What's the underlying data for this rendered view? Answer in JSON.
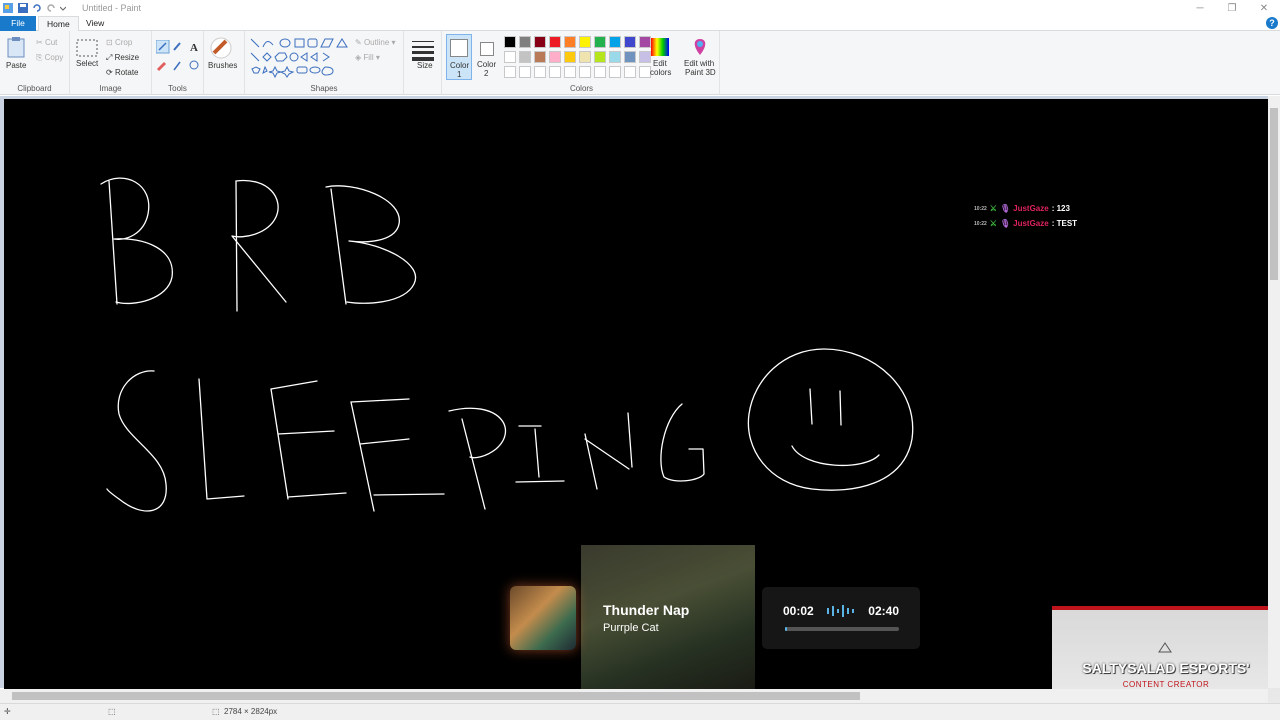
{
  "window": {
    "title": "Untitled - Paint",
    "controls": [
      "minimize",
      "restore",
      "close"
    ]
  },
  "ribbon_tabs": [
    {
      "label": "File"
    },
    {
      "label": "Home"
    },
    {
      "label": "View"
    }
  ],
  "clipboard": {
    "paste": "Paste",
    "cut": "Cut",
    "copy": "Copy",
    "group": "Clipboard"
  },
  "image": {
    "select": "Select",
    "crop": "Crop",
    "resize": "Resize",
    "rotate": "Rotate",
    "group": "Image"
  },
  "tools": {
    "group": "Tools",
    "brushes": "Brushes"
  },
  "shapes": {
    "group": "Shapes",
    "outline": "Outline",
    "fill": "Fill"
  },
  "size": {
    "label": "Size"
  },
  "colors": {
    "group": "Colors",
    "color1": "Color",
    "color1_num": "1",
    "color2": "Color",
    "color2_num": "2",
    "edit": "Edit",
    "edit2": "colors",
    "paint3d": "Edit with",
    "paint3d2": "Paint 3D",
    "palette_row1": [
      "#000000",
      "#7f7f7f",
      "#880015",
      "#ed1c24",
      "#ff7f27",
      "#fff200",
      "#22b14c",
      "#00a2e8",
      "#3f48cc",
      "#a349a4"
    ],
    "palette_row2": [
      "#ffffff",
      "#c3c3c3",
      "#b97a57",
      "#ffaec9",
      "#ffc90e",
      "#efe4b0",
      "#b5e61d",
      "#99d9ea",
      "#7092be",
      "#c8bfe7"
    ],
    "color1_value": "#ffffff",
    "color2_value": "#ffffff"
  },
  "chat": [
    {
      "time": "10:22",
      "user": "JustGaze",
      "message": ": 123"
    },
    {
      "time": "10:22",
      "user": "JustGaze",
      "message": ": TEST"
    }
  ],
  "now_playing": {
    "title": "Thunder Nap",
    "artist": "Purrple Cat",
    "elapsed": "00:02",
    "duration": "02:40",
    "progress": 0.02
  },
  "webcam_overlay": {
    "name": "SALTYSALAD ESPORTS'",
    "subtitle": "CONTENT CREATOR"
  },
  "status": {
    "dimensions": "2784 × 2824px"
  }
}
